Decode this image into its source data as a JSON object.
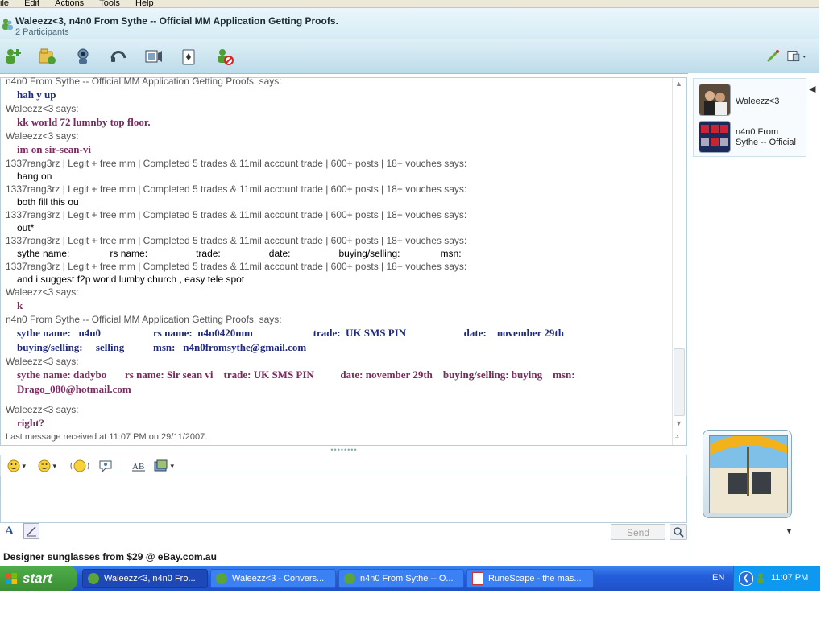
{
  "menubar": {
    "items": [
      "ile",
      "Edit",
      "Actions",
      "Tools",
      "Help"
    ]
  },
  "window": {
    "title": "Waleezz<3, n4n0 From Sythe -- Official MM Application Getting Proofs.",
    "subtitle": "2 Participants"
  },
  "toolbar": {
    "icons": [
      "invite-contact-icon",
      "send-files-icon",
      "video-call-icon",
      "voice-call-icon",
      "activities-icon",
      "games-icon",
      "block-icon"
    ],
    "right_icons": [
      "brush-icon",
      "menu-icon"
    ]
  },
  "conversation": {
    "messages": [
      {
        "sender": "n4n0 From Sythe -- Official MM Application Getting Proofs. says:",
        "lines": [
          "hah y up"
        ],
        "style": "navy"
      },
      {
        "sender": "Waleezz<3 says:",
        "lines": [
          "kk world 72 lumnby top floor."
        ],
        "style": "purple"
      },
      {
        "sender": "Waleezz<3 says:",
        "lines": [
          "im on sir-sean-vi"
        ],
        "style": "purple"
      },
      {
        "sender": "1337rang3rz | Legit + free mm | Completed 5 trades & 11mil account trade | 600+ posts | 18+ vouches says:",
        "lines": [
          "hang on"
        ],
        "style": "plain"
      },
      {
        "sender": "1337rang3rz | Legit + free mm | Completed 5 trades & 11mil account trade | 600+ posts | 18+ vouches says:",
        "lines": [
          "both fill this ou"
        ],
        "style": "plain"
      },
      {
        "sender": "1337rang3rz | Legit + free mm | Completed 5 trades & 11mil account trade | 600+ posts | 18+ vouches says:",
        "lines": [
          "out*"
        ],
        "style": "plain"
      },
      {
        "sender": "1337rang3rz | Legit + free mm | Completed 5 trades & 11mil account trade | 600+ posts | 18+ vouches says:",
        "lines": [
          "sythe name:               rs name:                  trade:                  date:                  buying/selling:               msn:"
        ],
        "style": "plain"
      },
      {
        "sender": "1337rang3rz | Legit + free mm | Completed 5 trades & 11mil account trade | 600+ posts | 18+ vouches says:",
        "lines": [
          "and i suggest f2p world lumby church , easy tele spot"
        ],
        "style": "plain"
      },
      {
        "sender": "Waleezz<3 says:",
        "lines": [
          "k"
        ],
        "style": "purple"
      },
      {
        "sender": "n4n0 From Sythe -- Official MM Application Getting Proofs. says:",
        "lines": [
          "sythe name:   n4n0                    rs name:  n4n0420mm                       trade:  UK SMS PIN                      date:    november 29th",
          "buying/selling:     selling           msn:   n4n0fromsythe@gmail.com"
        ],
        "style": "navy"
      },
      {
        "sender": "Waleezz<3 says:",
        "lines": [
          "sythe name: dadybo       rs name: Sir sean vi    trade: UK SMS PIN          date: november 29th    buying/selling: buying    msn:",
          "Drago_080@hotmail.com"
        ],
        "style": "purple",
        "trailing_gap": true
      },
      {
        "sender": "Waleezz<3 says:",
        "lines": [
          "right?"
        ],
        "style": "purple"
      }
    ],
    "status": "Last message received at 11:07 PM on 29/11/2007."
  },
  "format_bar": {
    "icons": [
      "emoticon-icon",
      "wink-icon",
      "nudge-icon",
      "voice-clip-icon",
      "font-icon",
      "background-icon"
    ]
  },
  "compose": {
    "value": ""
  },
  "bottom_tools": {
    "send_label": "Send"
  },
  "participants": [
    {
      "name": "Waleezz<3"
    },
    {
      "name": "n4n0 From Sythe -- Official"
    }
  ],
  "ad": {
    "text": "Designer sunglasses from $29 @ eBay.com.au"
  },
  "taskbar": {
    "start_label": "start",
    "buttons": [
      {
        "label": "Waleezz<3, n4n0 Fro...",
        "active": true
      },
      {
        "label": "Waleezz<3 - Convers...",
        "active": false
      },
      {
        "label": "n4n0 From Sythe -- O...",
        "active": false
      },
      {
        "label": "RuneScape - the mas...",
        "active": false
      }
    ],
    "lang": "EN",
    "time": "11:07 PM"
  },
  "colors": {
    "navy_text": "#1f2b7a",
    "purple_text": "#7a2a5e",
    "taskbar_blue": "#245edb",
    "start_green": "#3a8f35"
  }
}
